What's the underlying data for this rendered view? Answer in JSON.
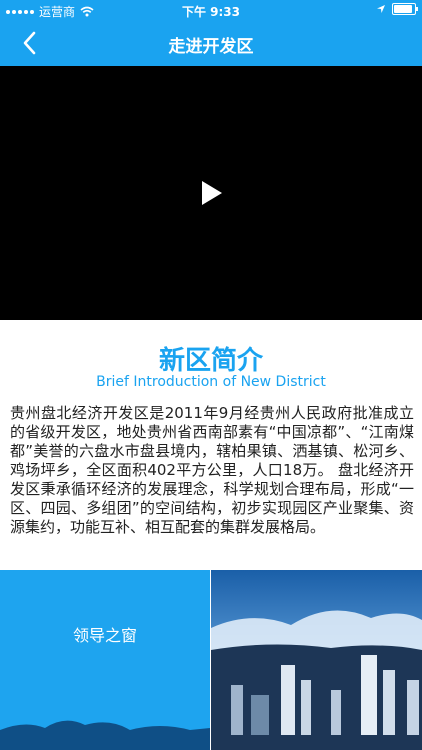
{
  "status_bar": {
    "carrier": "运营商",
    "time": "下午 9:33"
  },
  "nav": {
    "title": "走进开发区",
    "back_icon": "chevron-left-icon"
  },
  "video": {
    "play_icon": "play-icon"
  },
  "intro": {
    "title": "新区简介",
    "subtitle": "Brief Introduction of New District",
    "body": "贵州盘北经济开发区是2011年9月经贵州人民政府批准成立的省级开发区，地处贵州省西南部素有“中国凉都”、“江南煤都”美誉的六盘水市盘县境内，辖柏果镇、洒基镇、松河乡、鸡场坪乡，全区面积402平方公里，人口18万。 盘北经济开发区秉承循环经济的发展理念，科学规划合理布局，形成“一区、四园、多组团”的空间结构，初步实现园区产业聚集、资源集约，功能互补、相互配套的集群发展格局。"
  },
  "tiles": {
    "leader_label": "领导之窗"
  },
  "colors": {
    "accent": "#1aa3f0",
    "tile": "#1ea4ef",
    "video_bg": "#000000"
  }
}
